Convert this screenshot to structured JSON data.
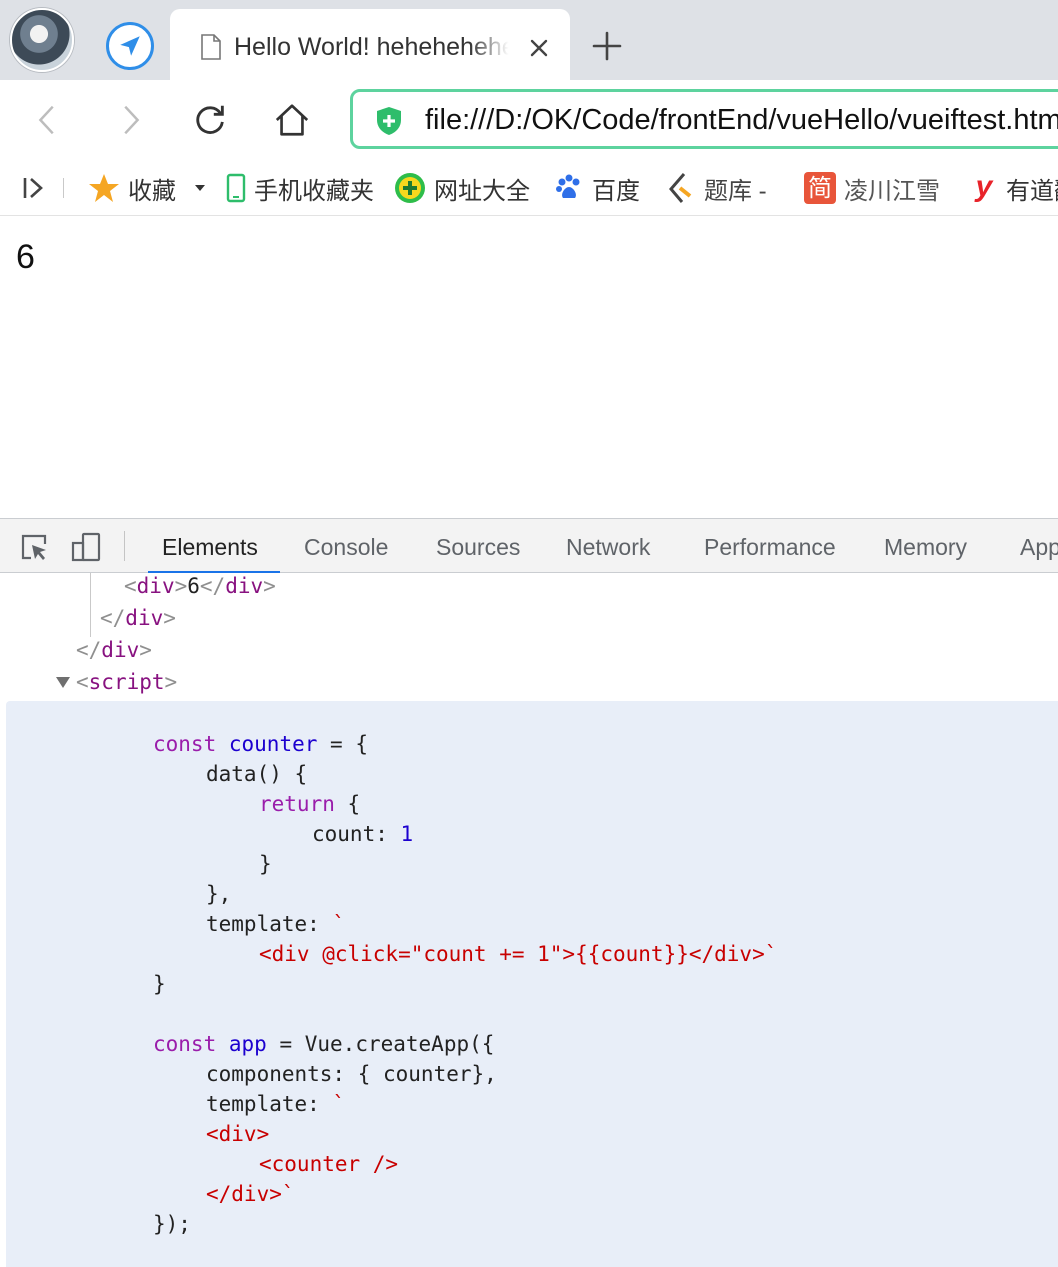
{
  "browser": {
    "tab": {
      "title": "Hello World! hehehehehe",
      "close_label": "×"
    },
    "new_tab_label": "+",
    "address": {
      "url": "file:///D:/OK/Code/frontEnd/vueHello/vueiftest.html"
    }
  },
  "bookmarks": {
    "items": [
      {
        "label": "收藏",
        "icon": "star-icon"
      },
      {
        "label": "手机收藏夹",
        "icon": "mobile-icon"
      },
      {
        "label": "网址大全",
        "icon": "plus-globe-icon"
      },
      {
        "label": "百度",
        "icon": "baidu-paw-icon"
      },
      {
        "label": "题库 -",
        "icon": "tiku-icon"
      },
      {
        "label": "凌川江雪",
        "icon": "jian-icon"
      },
      {
        "label": "有道翻译",
        "icon": "youdao-icon"
      }
    ],
    "jian_glyph": "简",
    "youdao_glyph": "y"
  },
  "page": {
    "counter_value": "6"
  },
  "devtools": {
    "tabs": [
      "Elements",
      "Console",
      "Sources",
      "Network",
      "Performance",
      "Memory",
      "Application"
    ],
    "active_tab": "Elements",
    "dom": {
      "div_tag": "div",
      "div_text": "6",
      "script_tag": "script"
    },
    "script": {
      "line1": {
        "kw": "const",
        "name": "counter",
        "rest": " = {"
      },
      "line2": "data() {",
      "line3": {
        "kw": "return",
        "rest": " {"
      },
      "line4": {
        "key": "count: ",
        "value": "1"
      },
      "line5": "}",
      "line6": "},",
      "line7": {
        "key": "template: ",
        "tick": "`"
      },
      "line8": "<div @click=\"count += 1\">{{count}}</div>`",
      "line9": "}",
      "line10": {
        "kw": "const",
        "name": "app",
        "rest": " = Vue.createApp({"
      },
      "line11": "components: { counter},",
      "line12": {
        "key": "template: ",
        "tick": "`"
      },
      "line13": "<div>",
      "line14": "<counter />",
      "line15": "</div>`",
      "line16": "});"
    }
  },
  "colors": {
    "tabstrip": "#dee1e6",
    "omnibox_border": "#5dd39e",
    "active_tab_indicator": "#1a73e8",
    "script_bg": "#e8eef8",
    "tag": "#881280",
    "keyword": "#aa0d91",
    "string": "#c80000",
    "number": "#1c00cf"
  }
}
